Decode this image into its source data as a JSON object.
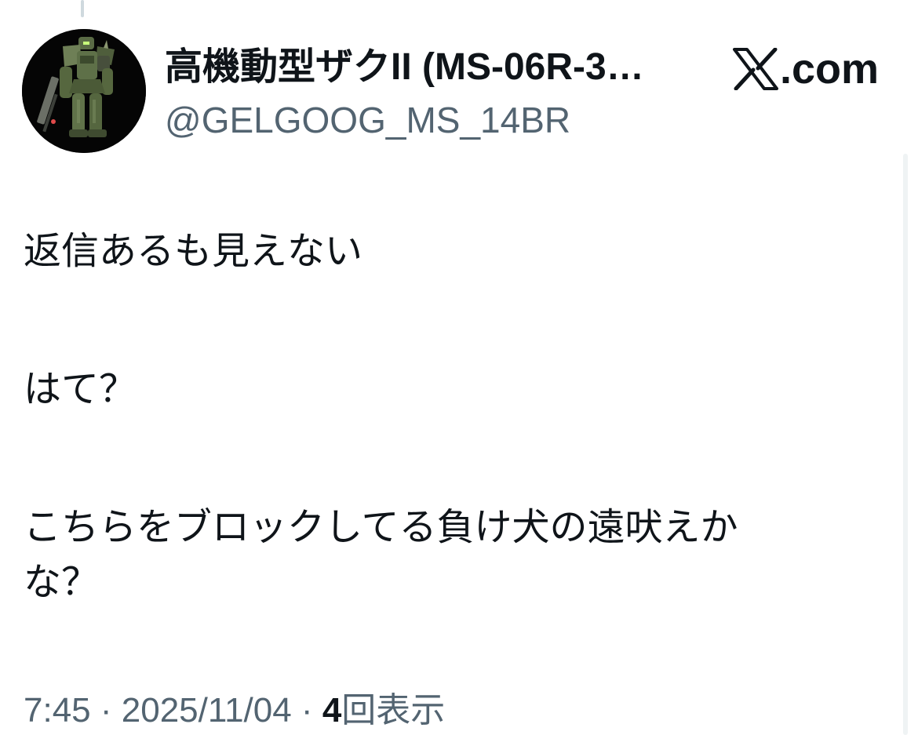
{
  "tweet": {
    "display_name": "高機動型ザクII (MS-06R-3…",
    "handle": "@GELGOOG_MS_14BR",
    "brand": "X.com",
    "brand_domain": ".com",
    "avatar_icon": "zaku-mobile-suit-avatar",
    "lines": [
      "返信あるも見えない",
      "はて？",
      "こちらをブロックしてる負け犬の遠吠えか",
      "な？"
    ],
    "time": "7:45",
    "separator": " · ",
    "date": "2025/11/04",
    "views_count": "4",
    "views_label": "回表示"
  },
  "colors": {
    "text_primary": "#0f1419",
    "text_secondary": "#536471",
    "thread_line": "#cfd9de",
    "background": "#ffffff"
  }
}
